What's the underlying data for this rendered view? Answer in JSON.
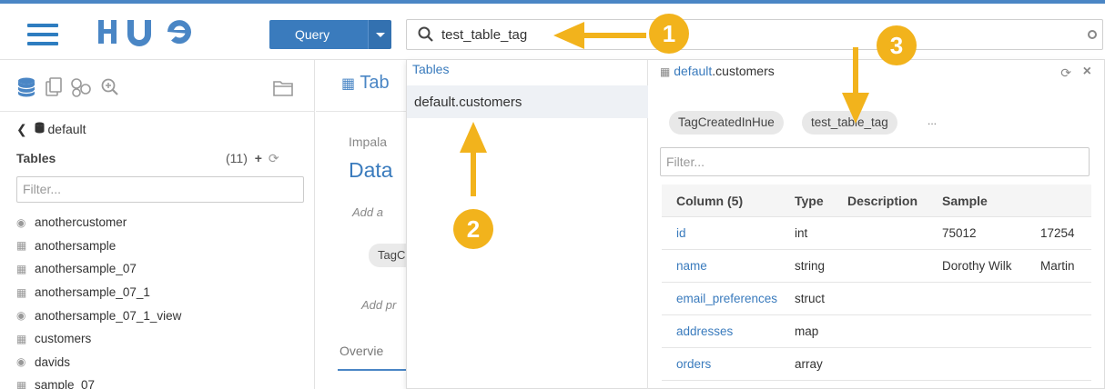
{
  "header": {
    "query_label": "Query",
    "search_value": "test_table_tag"
  },
  "left_panel": {
    "breadcrumb": "default",
    "tables_label": "Tables",
    "tables_count": "(11)",
    "filter_placeholder": "Filter...",
    "tables": [
      {
        "name": "anothercustomer",
        "icon": "view-icon"
      },
      {
        "name": "anothersample",
        "icon": "table-icon"
      },
      {
        "name": "anothersample_07",
        "icon": "table-icon"
      },
      {
        "name": "anothersample_07_1",
        "icon": "table-icon"
      },
      {
        "name": "anothersample_07_1_view",
        "icon": "view-icon"
      },
      {
        "name": "customers",
        "icon": "table-icon"
      },
      {
        "name": "davids",
        "icon": "view-icon"
      },
      {
        "name": "sample_07",
        "icon": "table-icon"
      }
    ]
  },
  "middle": {
    "tab_label": "Tab",
    "impala_label": "Impala",
    "data_title": "Data",
    "add_a": "Add a",
    "tag_partial": "TagC",
    "add_pr": "Add pr",
    "overview": "Overvie"
  },
  "dropdown": {
    "section_title": "Tables",
    "result": "default.customers",
    "detail": {
      "db": "default",
      "table": ".customers",
      "tags": [
        "TagCreatedInHue",
        "test_table_tag"
      ],
      "more": "...",
      "filter_placeholder": "Filter...",
      "columns_header": [
        "Column (5)",
        "Type",
        "Description",
        "Sample",
        ""
      ],
      "rows": [
        {
          "name": "id",
          "type": "int",
          "desc": "",
          "s1": "75012",
          "s2": "17254"
        },
        {
          "name": "name",
          "type": "string",
          "desc": "",
          "s1": "Dorothy Wilk",
          "s2": "Martin"
        },
        {
          "name": "email_preferences",
          "type": "struct",
          "desc": "",
          "s1": "",
          "s2": ""
        },
        {
          "name": "addresses",
          "type": "map",
          "desc": "",
          "s1": "",
          "s2": ""
        },
        {
          "name": "orders",
          "type": "array",
          "desc": "",
          "s1": "",
          "s2": ""
        }
      ]
    }
  },
  "annotations": [
    "1",
    "2",
    "3"
  ],
  "colors": {
    "accent": "#3a7bbd",
    "badge": "#f2b31c"
  }
}
